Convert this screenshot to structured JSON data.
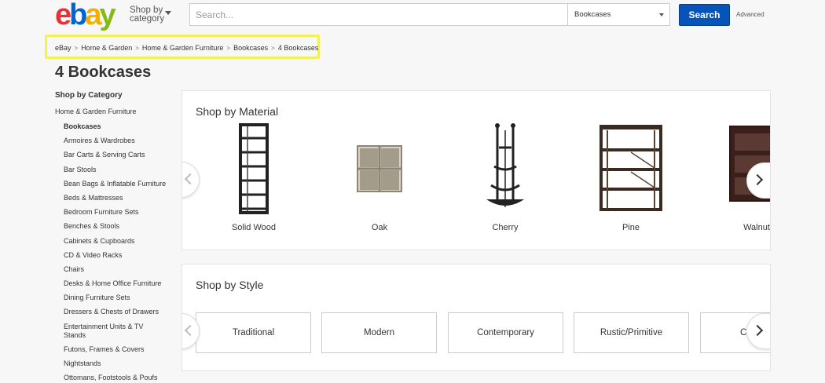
{
  "header": {
    "logo_letters": [
      "e",
      "b",
      "a",
      "y"
    ],
    "logo_colors": [
      "#e53238",
      "#0064d2",
      "#f5af02",
      "#86b817"
    ],
    "shop_by_category": [
      "Shop by",
      "category"
    ],
    "search_placeholder": "Search...",
    "category_selected": "Bookcases",
    "search_button": "Search",
    "advanced_link": "Advanced"
  },
  "breadcrumb": [
    "eBay",
    "Home & Garden",
    "Home & Garden Furniture",
    "Bookcases",
    "4 Bookcases"
  ],
  "page_title": "4 Bookcases",
  "sidebar": {
    "heading": "Shop by Category",
    "parent": "Home & Garden Furniture",
    "items": [
      "Bookcases",
      "Armoires & Wardrobes",
      "Bar Carts & Serving Carts",
      "Bar Stools",
      "Bean Bags & Inflatable Furniture",
      "Beds & Mattresses",
      "Bedroom Furniture Sets",
      "Benches & Stools",
      "Cabinets & Cupboards",
      "CD & Video Racks",
      "Chairs",
      "Desks & Home Office Furniture",
      "Dining Furniture Sets",
      "Dressers & Chests of Drawers",
      "Entertainment Units & TV Stands",
      "Futons, Frames & Covers",
      "Nightstands",
      "Ottomans, Footstools & Poufs"
    ]
  },
  "material": {
    "title": "Shop by Material",
    "items": [
      "Solid Wood",
      "Oak",
      "Cherry",
      "Pine",
      "Walnut"
    ]
  },
  "style": {
    "title": "Shop by Style",
    "items": [
      "Traditional",
      "Modern",
      "Contemporary",
      "Rustic/Primitive",
      "Co"
    ]
  },
  "icons": {
    "prev": "chevron-left-icon",
    "next": "chevron-right-icon",
    "dropdown": "caret-down-icon"
  }
}
